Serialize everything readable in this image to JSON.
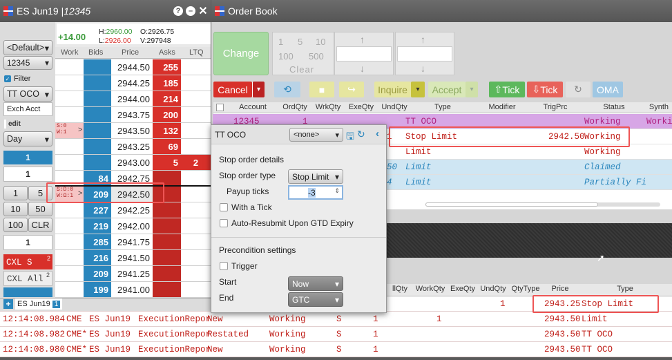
{
  "left_window": {
    "title": "ES Jun19 | ",
    "title_account": "12345",
    "change": "+14.00",
    "high_label": "H:",
    "high": "2960.00",
    "low_label": "L:",
    "low": "2926.00",
    "open_label": "O:",
    "open": "2926.75",
    "vol_label": "V:",
    "volume": "297948"
  },
  "left_panel": {
    "account_group": "<Default>",
    "account": "12345",
    "filter_label": "Filter",
    "filter_checked": true,
    "order_type": "TT OCO",
    "exch_acct": "Exch Acct",
    "edit_label": "edit",
    "tif": "Day",
    "qty_blue": "1",
    "qty_input": "1",
    "qty_buttons": [
      "1",
      "5",
      "10",
      "50",
      "100",
      "CLR"
    ],
    "qty_input2": "1",
    "cxl_s": "CXL S",
    "cxl_s_count": "2",
    "cxl_all": "CXL All",
    "cxl_all_count": "2"
  },
  "ladder": {
    "headers": [
      "Work",
      "Bids",
      "Price",
      "Asks",
      "LTQ"
    ],
    "rows": [
      {
        "price": "2944.50",
        "ask": "255"
      },
      {
        "price": "2944.25",
        "ask": "185"
      },
      {
        "price": "2944.00",
        "ask": "214"
      },
      {
        "price": "2943.75",
        "ask": "200"
      },
      {
        "price": "2943.50",
        "ask": "132",
        "work": [
          "S:0",
          "W:1"
        ],
        "arrow": ">"
      },
      {
        "price": "2943.25",
        "ask": "69"
      },
      {
        "price": "2943.00",
        "ask": "5",
        "ltq": "2"
      },
      {
        "price": "2942.75",
        "bid": "84"
      },
      {
        "price": "2942.50",
        "bid": "209",
        "work": [
          "S:D:0",
          "W:Ω:1"
        ],
        "arrow": ">"
      },
      {
        "price": "2942.25",
        "bid": "227"
      },
      {
        "price": "2942.00",
        "bid": "219"
      },
      {
        "price": "2941.75",
        "bid": "285"
      },
      {
        "price": "2941.50",
        "bid": "216"
      },
      {
        "price": "2941.25",
        "bid": "209"
      },
      {
        "price": "2941.00",
        "bid": "199"
      }
    ]
  },
  "left_tabs": {
    "add": "+",
    "tab": "ES Jun19",
    "tab_count": "1"
  },
  "order_book": {
    "title": "Order Book",
    "change_label": "Change",
    "qty_row1": [
      "1",
      "5",
      "10"
    ],
    "qty_row2": [
      "100",
      "500"
    ],
    "clear_label": "Clear",
    "toolbar": {
      "cancel": "Cancel",
      "inquire": "Inquire",
      "accept": "Accept",
      "tick_up": "Tick",
      "tick_down": "Tick",
      "oma": "OMA"
    },
    "headers": [
      "Account",
      "OrdQty",
      "WrkQty",
      "ExeQty",
      "UndQty",
      "Type",
      "Modifier",
      "TrigPrc",
      "Status",
      "Synth"
    ],
    "rows": [
      {
        "account": "12345",
        "ordqty": "1",
        "type": "TT OCO",
        "status": "Working",
        "synth": "Working",
        "style": "purple"
      },
      {
        "undqty": "1",
        "type": "Stop Limit",
        "trigprc": "2942.50",
        "status": "Working",
        "style": "red"
      },
      {
        "type": "Limit",
        "status": "Working",
        "style": "red"
      },
      {
        "undqty": "50",
        "type": "Limit",
        "status": "Claimed",
        "style": "blue"
      },
      {
        "undqty": "4",
        "type": "Limit",
        "status": "Partially Fi",
        "style": "blue"
      }
    ]
  },
  "fills": {
    "headers": [
      "llQty",
      "WorkQty",
      "ExeQty",
      "UndQty",
      "QtyType",
      "Price",
      "Type"
    ],
    "rows": [
      {
        "undqty": "1",
        "price": "2943.25",
        "type": "Stop Limit"
      },
      {
        "time": "12:14:08.984",
        "exch": "CME",
        "contract": "ES Jun19",
        "msg": "ExecutionRepor",
        "exectype": "New",
        "status": "Working",
        "side": "S",
        "ordqty": "1",
        "workqty": "1",
        "price": "2943.50",
        "type": "Limit"
      },
      {
        "time": "12:14:08.982",
        "exch": "CME*",
        "contract": "ES Jun19",
        "msg": "ExecutionRepor",
        "exectype": "Restated",
        "status": "Working",
        "side": "S",
        "ordqty": "1",
        "price": "2943.50",
        "type": "TT OCO"
      },
      {
        "time": "12:14:08.980",
        "exch": "CME*",
        "contract": "ES Jun19",
        "msg": "ExecutionRepor",
        "exectype": "New",
        "status": "Working",
        "side": "S",
        "ordqty": "1",
        "price": "2943.50",
        "type": "TT OCO"
      }
    ]
  },
  "popup": {
    "title": "TT OCO",
    "template": "<none>",
    "section1": "Stop order details",
    "stop_type_label": "Stop order type",
    "stop_type": "Stop Limit",
    "payup_label": "Payup ticks",
    "payup": "-3",
    "with_tick": "With a Tick",
    "auto_resubmit": "Auto-Resubmit Upon GTD Expiry",
    "section2": "Precondition settings",
    "trigger": "Trigger",
    "start_label": "Start",
    "start": "Now",
    "end_label": "End",
    "end": "GTC"
  },
  "colors": {
    "bid": "#2a86bd",
    "ask": "#d8302a",
    "highlight": "#e55a4a",
    "purple_row": "#d7a6e6",
    "blue_row": "#cfe6f3",
    "accent_green": "#5cb85c"
  }
}
